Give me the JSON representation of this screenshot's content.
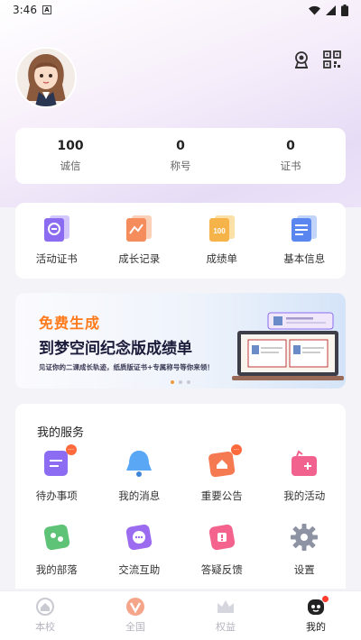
{
  "status": {
    "time": "3:46",
    "notif_glyph": "A"
  },
  "header": {
    "avatar_icon": "girl-avatar-icon",
    "badge_icon": "badge-icon",
    "qr_icon": "qr-code-icon"
  },
  "stats": [
    {
      "value": "100",
      "label": "诚信"
    },
    {
      "value": "0",
      "label": "称号"
    },
    {
      "value": "0",
      "label": "证书"
    }
  ],
  "quick": [
    {
      "label": "活动证书",
      "icon": "certificate-icon",
      "color": "#8b6cf0"
    },
    {
      "label": "成长记录",
      "icon": "growth-chart-icon",
      "color": "#f58c5b"
    },
    {
      "label": "成绩单",
      "icon": "score-100-icon",
      "color": "#f5b34a"
    },
    {
      "label": "基本信息",
      "icon": "profile-doc-icon",
      "color": "#5a86f0"
    }
  ],
  "banner": {
    "line1": "免费生成",
    "line2": "到梦空间纪念版成绩单",
    "line3": "见证你的二课成长轨迹，纸质版证书+专属称号等你来领！"
  },
  "services": {
    "title": "我的服务",
    "items": [
      {
        "label": "待办事项",
        "icon": "todo-list-icon",
        "color": "#8c6cf2",
        "badge": "···"
      },
      {
        "label": "我的消息",
        "icon": "bell-icon",
        "color": "#5aa7f5",
        "badge": ""
      },
      {
        "label": "重要公告",
        "icon": "announcement-icon",
        "color": "#f57a52",
        "badge": "···"
      },
      {
        "label": "我的活动",
        "icon": "activity-bag-icon",
        "color": "#f2628f",
        "badge": ""
      },
      {
        "label": "我的部落",
        "icon": "tribe-icon",
        "color": "#5ec277",
        "badge": ""
      },
      {
        "label": "交流互助",
        "icon": "chat-icon",
        "color": "#9c6cf0",
        "badge": ""
      },
      {
        "label": "答疑反馈",
        "icon": "feedback-icon",
        "color": "#f4638e",
        "badge": ""
      },
      {
        "label": "设置",
        "icon": "gear-icon",
        "color": "#8d93a3",
        "badge": ""
      }
    ]
  },
  "nav": [
    {
      "label": "本校",
      "icon": "school-icon"
    },
    {
      "label": "全国",
      "icon": "nationwide-icon"
    },
    {
      "label": "权益",
      "icon": "crown-icon"
    },
    {
      "label": "我的",
      "icon": "mine-icon"
    }
  ]
}
